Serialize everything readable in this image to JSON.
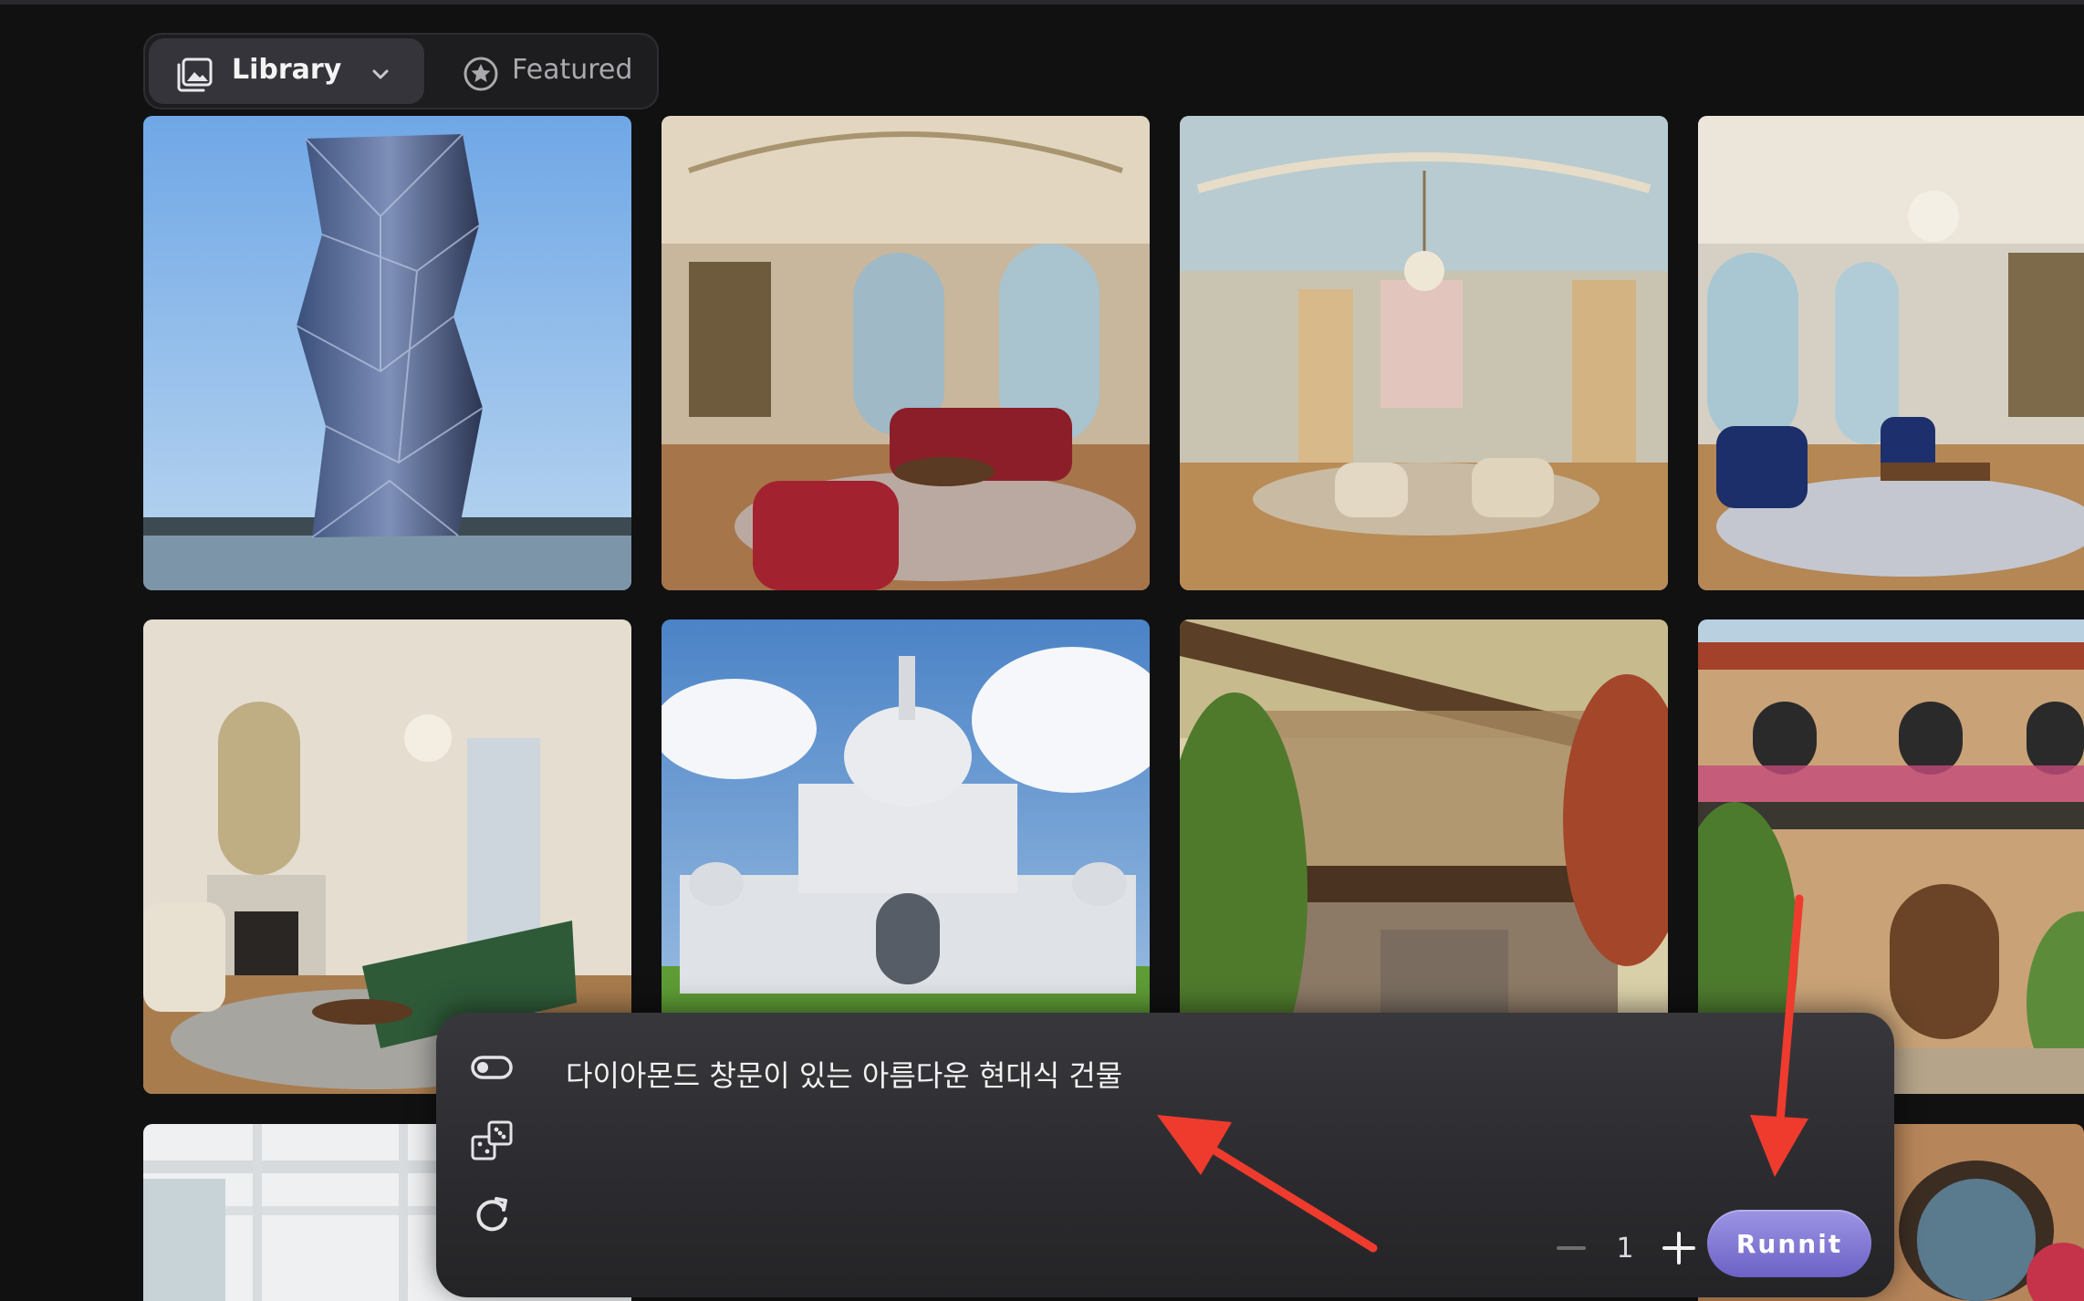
{
  "tabs": {
    "library_label": "Library",
    "featured_label": "Featured",
    "library_icon": "gallery-icon",
    "featured_icon": "star-circle-icon",
    "dropdown_icon": "chevron-down-icon"
  },
  "prompt": {
    "text": "다이아몬드 창문이 있는 아름다운 현대식 건물",
    "toggle_icon": "toggle-icon",
    "random_icon": "dice-icon",
    "reset_icon": "refresh-icon"
  },
  "generate": {
    "count": "1",
    "run_label": "Runnit"
  },
  "colors": {
    "accent": "#8077d6",
    "annotation": "#ef3b2d",
    "background": "#111112"
  }
}
